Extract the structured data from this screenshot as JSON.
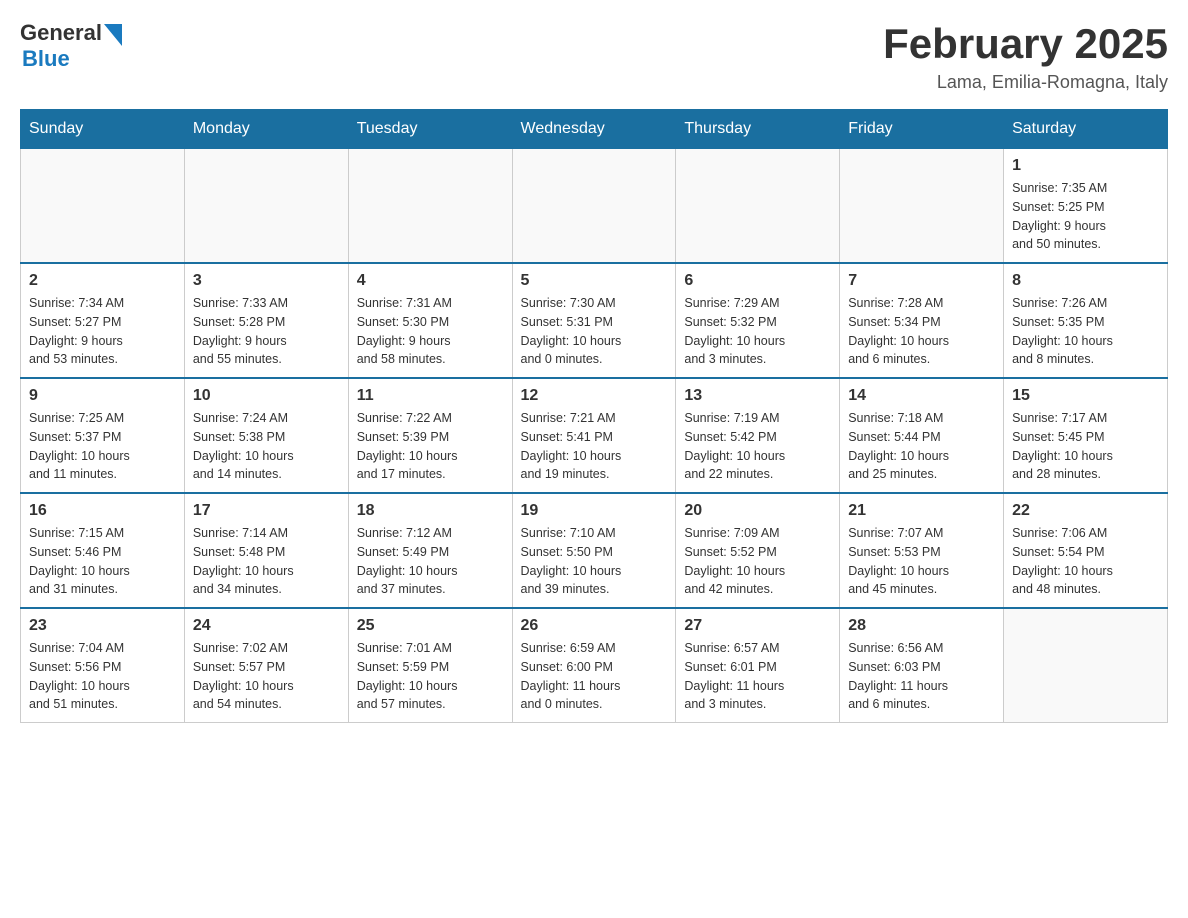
{
  "header": {
    "logo_general": "General",
    "logo_blue": "Blue",
    "title": "February 2025",
    "subtitle": "Lama, Emilia-Romagna, Italy"
  },
  "days_of_week": [
    "Sunday",
    "Monday",
    "Tuesday",
    "Wednesday",
    "Thursday",
    "Friday",
    "Saturday"
  ],
  "weeks": [
    [
      {
        "day": "",
        "info": ""
      },
      {
        "day": "",
        "info": ""
      },
      {
        "day": "",
        "info": ""
      },
      {
        "day": "",
        "info": ""
      },
      {
        "day": "",
        "info": ""
      },
      {
        "day": "",
        "info": ""
      },
      {
        "day": "1",
        "info": "Sunrise: 7:35 AM\nSunset: 5:25 PM\nDaylight: 9 hours\nand 50 minutes."
      }
    ],
    [
      {
        "day": "2",
        "info": "Sunrise: 7:34 AM\nSunset: 5:27 PM\nDaylight: 9 hours\nand 53 minutes."
      },
      {
        "day": "3",
        "info": "Sunrise: 7:33 AM\nSunset: 5:28 PM\nDaylight: 9 hours\nand 55 minutes."
      },
      {
        "day": "4",
        "info": "Sunrise: 7:31 AM\nSunset: 5:30 PM\nDaylight: 9 hours\nand 58 minutes."
      },
      {
        "day": "5",
        "info": "Sunrise: 7:30 AM\nSunset: 5:31 PM\nDaylight: 10 hours\nand 0 minutes."
      },
      {
        "day": "6",
        "info": "Sunrise: 7:29 AM\nSunset: 5:32 PM\nDaylight: 10 hours\nand 3 minutes."
      },
      {
        "day": "7",
        "info": "Sunrise: 7:28 AM\nSunset: 5:34 PM\nDaylight: 10 hours\nand 6 minutes."
      },
      {
        "day": "8",
        "info": "Sunrise: 7:26 AM\nSunset: 5:35 PM\nDaylight: 10 hours\nand 8 minutes."
      }
    ],
    [
      {
        "day": "9",
        "info": "Sunrise: 7:25 AM\nSunset: 5:37 PM\nDaylight: 10 hours\nand 11 minutes."
      },
      {
        "day": "10",
        "info": "Sunrise: 7:24 AM\nSunset: 5:38 PM\nDaylight: 10 hours\nand 14 minutes."
      },
      {
        "day": "11",
        "info": "Sunrise: 7:22 AM\nSunset: 5:39 PM\nDaylight: 10 hours\nand 17 minutes."
      },
      {
        "day": "12",
        "info": "Sunrise: 7:21 AM\nSunset: 5:41 PM\nDaylight: 10 hours\nand 19 minutes."
      },
      {
        "day": "13",
        "info": "Sunrise: 7:19 AM\nSunset: 5:42 PM\nDaylight: 10 hours\nand 22 minutes."
      },
      {
        "day": "14",
        "info": "Sunrise: 7:18 AM\nSunset: 5:44 PM\nDaylight: 10 hours\nand 25 minutes."
      },
      {
        "day": "15",
        "info": "Sunrise: 7:17 AM\nSunset: 5:45 PM\nDaylight: 10 hours\nand 28 minutes."
      }
    ],
    [
      {
        "day": "16",
        "info": "Sunrise: 7:15 AM\nSunset: 5:46 PM\nDaylight: 10 hours\nand 31 minutes."
      },
      {
        "day": "17",
        "info": "Sunrise: 7:14 AM\nSunset: 5:48 PM\nDaylight: 10 hours\nand 34 minutes."
      },
      {
        "day": "18",
        "info": "Sunrise: 7:12 AM\nSunset: 5:49 PM\nDaylight: 10 hours\nand 37 minutes."
      },
      {
        "day": "19",
        "info": "Sunrise: 7:10 AM\nSunset: 5:50 PM\nDaylight: 10 hours\nand 39 minutes."
      },
      {
        "day": "20",
        "info": "Sunrise: 7:09 AM\nSunset: 5:52 PM\nDaylight: 10 hours\nand 42 minutes."
      },
      {
        "day": "21",
        "info": "Sunrise: 7:07 AM\nSunset: 5:53 PM\nDaylight: 10 hours\nand 45 minutes."
      },
      {
        "day": "22",
        "info": "Sunrise: 7:06 AM\nSunset: 5:54 PM\nDaylight: 10 hours\nand 48 minutes."
      }
    ],
    [
      {
        "day": "23",
        "info": "Sunrise: 7:04 AM\nSunset: 5:56 PM\nDaylight: 10 hours\nand 51 minutes."
      },
      {
        "day": "24",
        "info": "Sunrise: 7:02 AM\nSunset: 5:57 PM\nDaylight: 10 hours\nand 54 minutes."
      },
      {
        "day": "25",
        "info": "Sunrise: 7:01 AM\nSunset: 5:59 PM\nDaylight: 10 hours\nand 57 minutes."
      },
      {
        "day": "26",
        "info": "Sunrise: 6:59 AM\nSunset: 6:00 PM\nDaylight: 11 hours\nand 0 minutes."
      },
      {
        "day": "27",
        "info": "Sunrise: 6:57 AM\nSunset: 6:01 PM\nDaylight: 11 hours\nand 3 minutes."
      },
      {
        "day": "28",
        "info": "Sunrise: 6:56 AM\nSunset: 6:03 PM\nDaylight: 11 hours\nand 6 minutes."
      },
      {
        "day": "",
        "info": ""
      }
    ]
  ]
}
